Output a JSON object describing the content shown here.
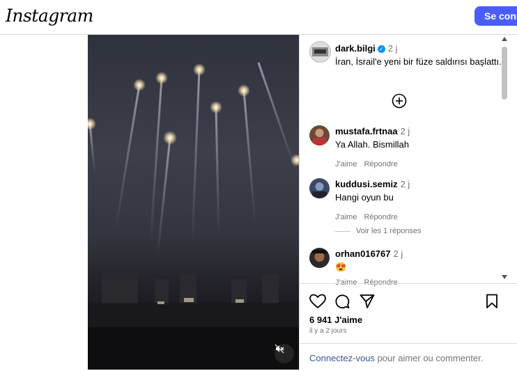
{
  "header": {
    "logo": "Instagram",
    "login_label": "Se conn"
  },
  "media": {
    "description_icon": "mute-icon"
  },
  "post": {
    "author": "dark.bilgi",
    "author_verified": true,
    "time": "2 j",
    "caption": "İran, İsrail'e yeni bir füze saldırısı başlattı."
  },
  "comments": [
    {
      "user": "mustafa.frtnaa",
      "time": "2 j",
      "text": "Ya Allah. Bismillah",
      "like": "J'aime",
      "reply": "Répondre"
    },
    {
      "user": "kuddusi.semiz",
      "time": "2 j",
      "text": "Hangi oyun bu",
      "like": "J'aime",
      "reply": "Répondre"
    },
    {
      "user": "orhan016767",
      "time": "2 j",
      "text": "😍",
      "like": "J'aime",
      "reply": "Répondre"
    }
  ],
  "view_replies": "Voir les 1 réponses",
  "footer": {
    "likes": "6 941 J'aime",
    "ago": "il y a 2 jours",
    "login_link": "Connectez-vous",
    "login_rest": " pour aimer ou commenter."
  },
  "colors": {
    "brand_button": "#4a5df9",
    "link": "#385898",
    "verified": "#0095f6"
  }
}
